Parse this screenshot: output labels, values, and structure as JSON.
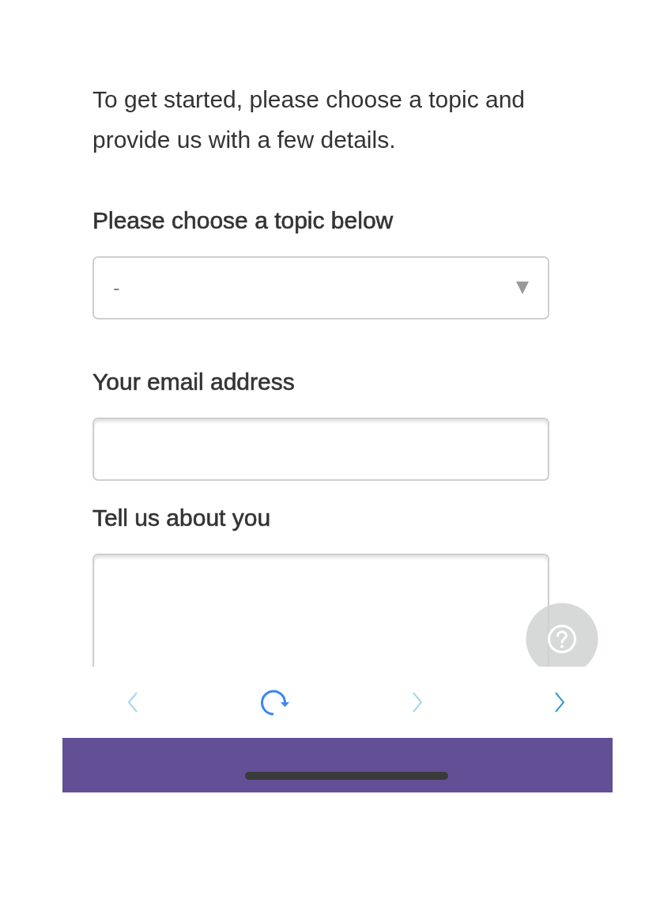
{
  "intro": "To get started, please choose a topic and provide us with a few details.",
  "form": {
    "fields": [
      {
        "kind": "select",
        "label": "Please choose a topic below",
        "value": "-"
      },
      {
        "kind": "input",
        "label": "Your email address"
      },
      {
        "kind": "textarea",
        "label": "Tell us about you"
      }
    ]
  },
  "toolbar": {
    "buttons": [
      {
        "kind": "back",
        "disabled": true
      },
      {
        "kind": "reload",
        "disabled": false
      },
      {
        "kind": "forward",
        "disabled": true
      },
      {
        "kind": "next",
        "disabled": false
      }
    ]
  }
}
